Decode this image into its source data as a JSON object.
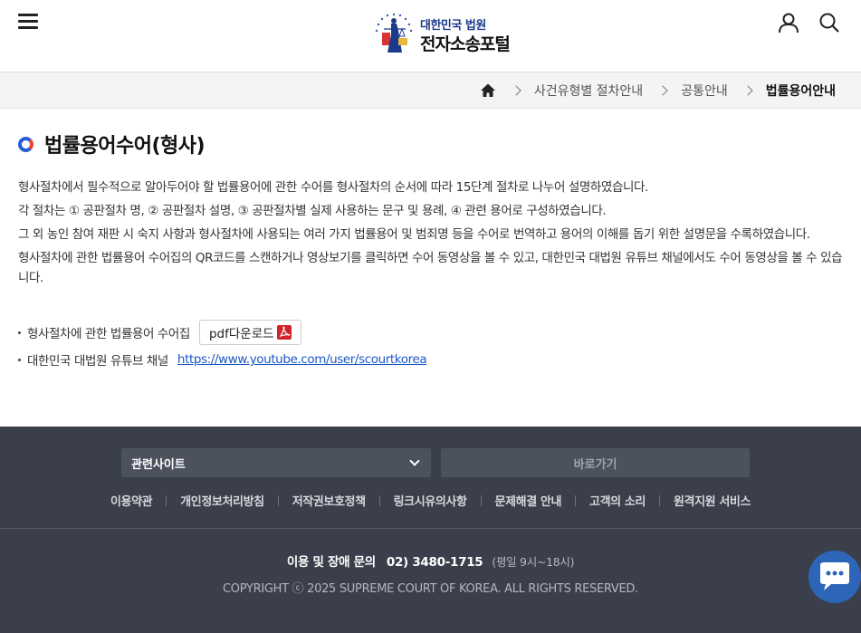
{
  "header": {
    "logo_sub": "대한민국 법원",
    "logo_main": "전자소송포털"
  },
  "breadcrumb": {
    "items": [
      "사건유형별 절차안내",
      "공통안내"
    ],
    "current": "법률용어안내"
  },
  "page": {
    "title": "법률용어수어(형사)",
    "paragraphs": [
      "형사절차에서 필수적으로 알아두어야 할 법률용어에 관한 수어를 형사절차의 순서에 따라 15단계 절차로 나누어 설명하였습니다.",
      "각 절차는 ① 공판절차 명, ② 공판절차 설명, ③ 공판절차별 실제 사용하는 문구 및 용례, ④ 관련 용어로 구성하였습니다.",
      "그 외 농인 참여 재판 시 숙지 사항과 형사절차에 사용되는 여러 가지 법률용어 및 범죄명 등을 수어로 번역하고 용어의 이해를 돕기 위한 설명문을 수록하였습니다.",
      "형사절차에 관한 법률용어 수어집의 QR코드를 스캔하거나 영상보기를 클릭하면 수어 동영상을 볼 수 있고, 대한민국 대법원 유튜브 채널에서도 수어 동영상을 볼 수 있습니다."
    ],
    "pdf_label": "형사절차에 관한 법률용어 수어집",
    "pdf_button": "pdf다운로드",
    "youtube_label": "대한민국 대법원 유튜브 채널",
    "youtube_url": "https://www.youtube.com/user/scourtkorea"
  },
  "footer": {
    "site_select": "관련사이트",
    "go_button": "바로가기",
    "links": [
      "이용약관",
      "개인정보처리방침",
      "저작권보호정책",
      "링크시유의사항",
      "문제해결 안내",
      "고객의 소리",
      "원격지원 서비스"
    ],
    "contact_label": "이용 및 장애 문의",
    "phone": "02) 3480-1715",
    "hours": "(평일 9시~18시)",
    "copyright": "COPYRIGHT ⓒ 2025 SUPREME COURT OF KOREA. ALL RIGHTS RESERVED."
  },
  "icons": {
    "menu": "hamburger-menu-icon",
    "user": "user-icon",
    "search": "search-icon",
    "home": "home-icon",
    "pdf": "pdf-icon",
    "chat": "chat-icon"
  },
  "colors": {
    "accent_blue": "#2a5bd7",
    "accent_red": "#e8473c",
    "link": "#1a57c7",
    "footer_bg": "#3b3f4b",
    "chat_bg": "#2d66b8"
  }
}
